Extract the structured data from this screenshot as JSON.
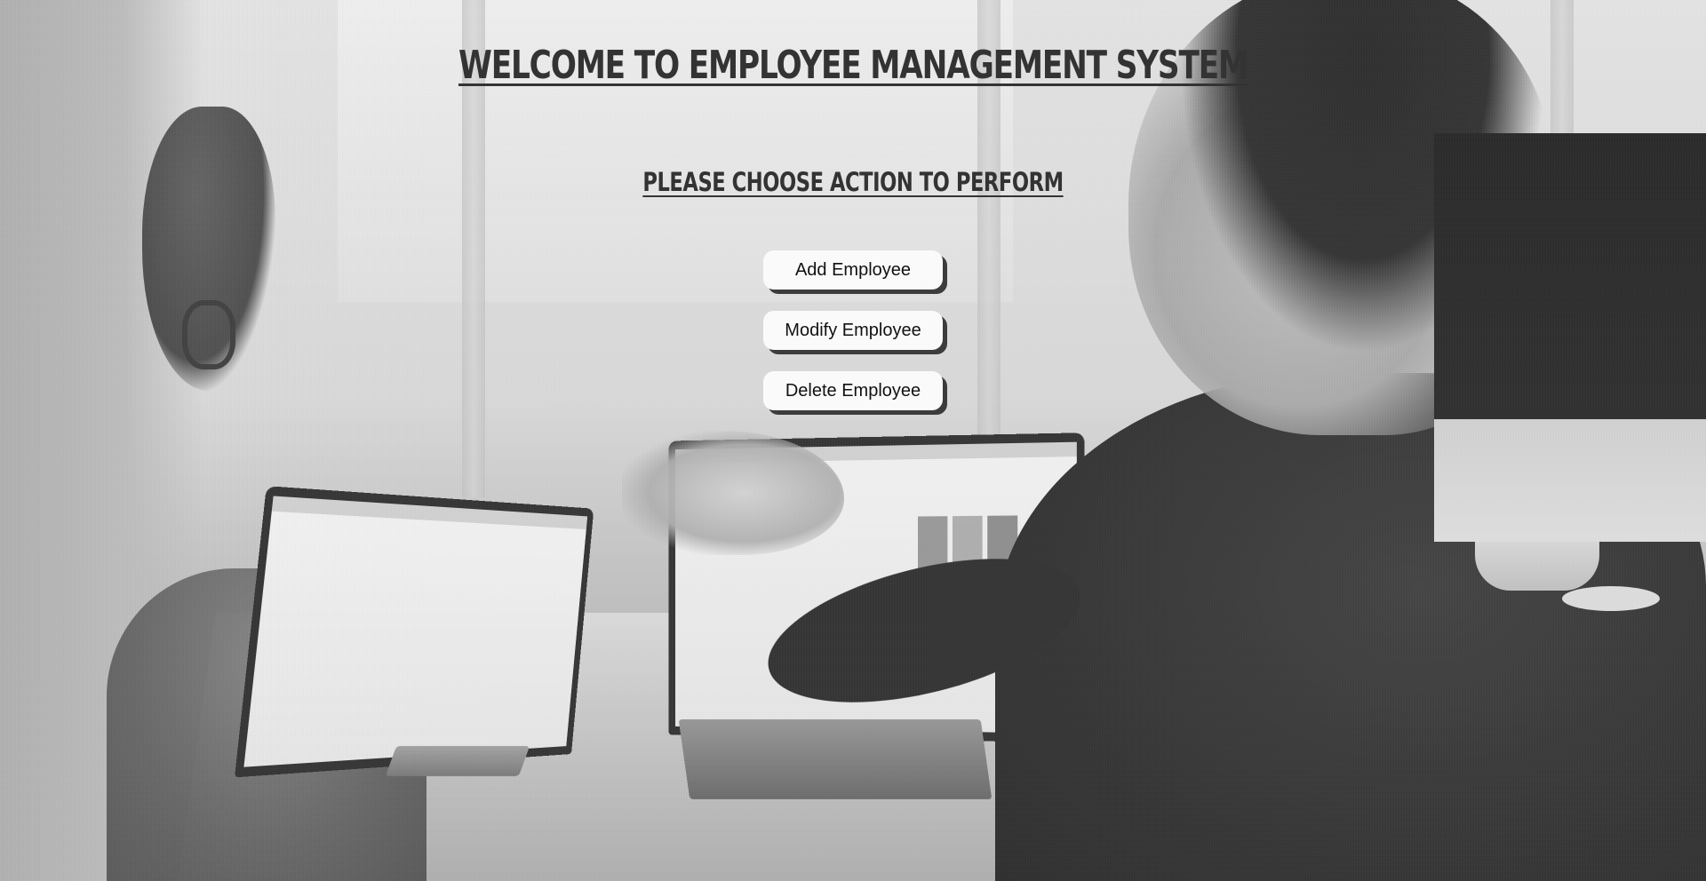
{
  "page": {
    "title": "Welcome To Employee Management System",
    "subtitle": "Please Choose Action To Perform"
  },
  "actions": [
    {
      "label": "Add Employee"
    },
    {
      "label": "Modify Employee"
    },
    {
      "label": "Delete Employee"
    }
  ],
  "colors": {
    "heading": "#333333",
    "button_bg": "#fafafa",
    "button_shadow": "#3c3c3c",
    "button_text": "#111111"
  }
}
